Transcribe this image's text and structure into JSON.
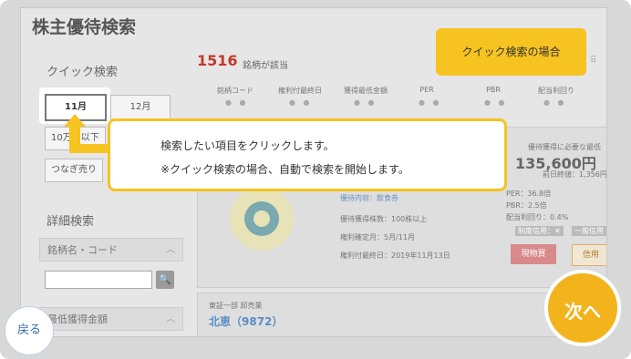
{
  "page": {
    "title": "株主優待検索"
  },
  "quick_search": {
    "label": "クイック検索",
    "months": [
      "11月",
      "12月"
    ],
    "active_month": "11月",
    "chips": [
      "10万円以下",
      "つなぎ売り"
    ]
  },
  "detail_search": {
    "label": "詳細検索",
    "fields": [
      "銘柄名・コード",
      "最低獲得金額"
    ]
  },
  "results": {
    "count": "1516",
    "count_suffix": "銘柄が該当",
    "columns": [
      "銘柄コード",
      "権利付最終日",
      "獲得最低金額",
      "PER",
      "PBR",
      "配当利回り"
    ]
  },
  "card1": {
    "benefit": "優待内容：飲食券",
    "min_shares": "優待獲得株数：100株以上",
    "record_month": "権利確定月：5月/11月",
    "last_day": "権利付最終日：2019年11月13日",
    "right_label": "優待獲得に必要な最低",
    "price": "135,600円",
    "prev_close": "前日終値：1,356円",
    "per": "PER：36.8倍",
    "pbr": "PBR：2.5倍",
    "yield": "配当利回り：0.4%",
    "badge": "制度信用：✕",
    "badge2": "一般信用",
    "cash_buy": "現物買",
    "credit": "信用"
  },
  "card2": {
    "market": "東証一部 卸売業",
    "name": "北恵（9872）"
  },
  "tag": {
    "text": "クイック検索の場合"
  },
  "callout": {
    "line1": "検索したい項目をクリックします。",
    "line2": "※クイック検索の場合、自動で検索を開始します。"
  },
  "nav": {
    "back": "戻る",
    "next": "次へ"
  },
  "colors": {
    "accent": "#f6c320",
    "link": "#3a6aa8",
    "count": "#c0392b"
  }
}
